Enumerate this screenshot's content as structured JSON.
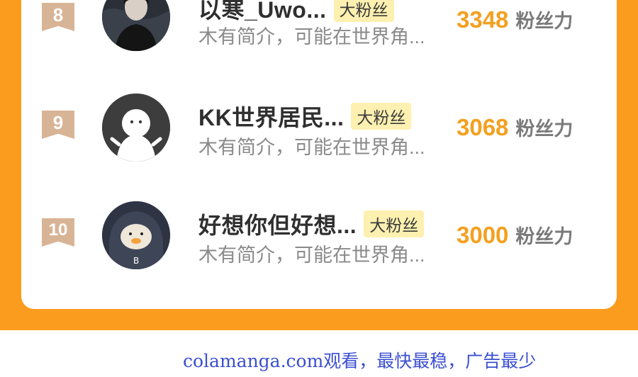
{
  "leaderboard": {
    "rows": [
      {
        "rank": "8",
        "name": "以寒_Uwo...",
        "badge": "大粉丝",
        "bio": "木有简介，可能在世界角...",
        "score": "3348",
        "score_unit": "粉丝力",
        "avatar": "photo-avatar"
      },
      {
        "rank": "9",
        "name": "KK世界居民...",
        "badge": "大粉丝",
        "bio": "木有简介，可能在世界角...",
        "score": "3068",
        "score_unit": "粉丝力",
        "avatar": "default-avatar"
      },
      {
        "rank": "10",
        "name": "好想你但好想...",
        "badge": "大粉丝",
        "bio": "木有简介，可能在世界角...",
        "score": "3000",
        "score_unit": "粉丝力",
        "avatar": "duck-avatar"
      }
    ]
  },
  "footer": {
    "text": "colamanga.com观看，最快最稳，广告最少"
  },
  "colors": {
    "accent": "#fb9c1e",
    "score": "#f3a020",
    "badge_bg": "#fdf0b0",
    "rank_ribbon": "#d8b496"
  }
}
